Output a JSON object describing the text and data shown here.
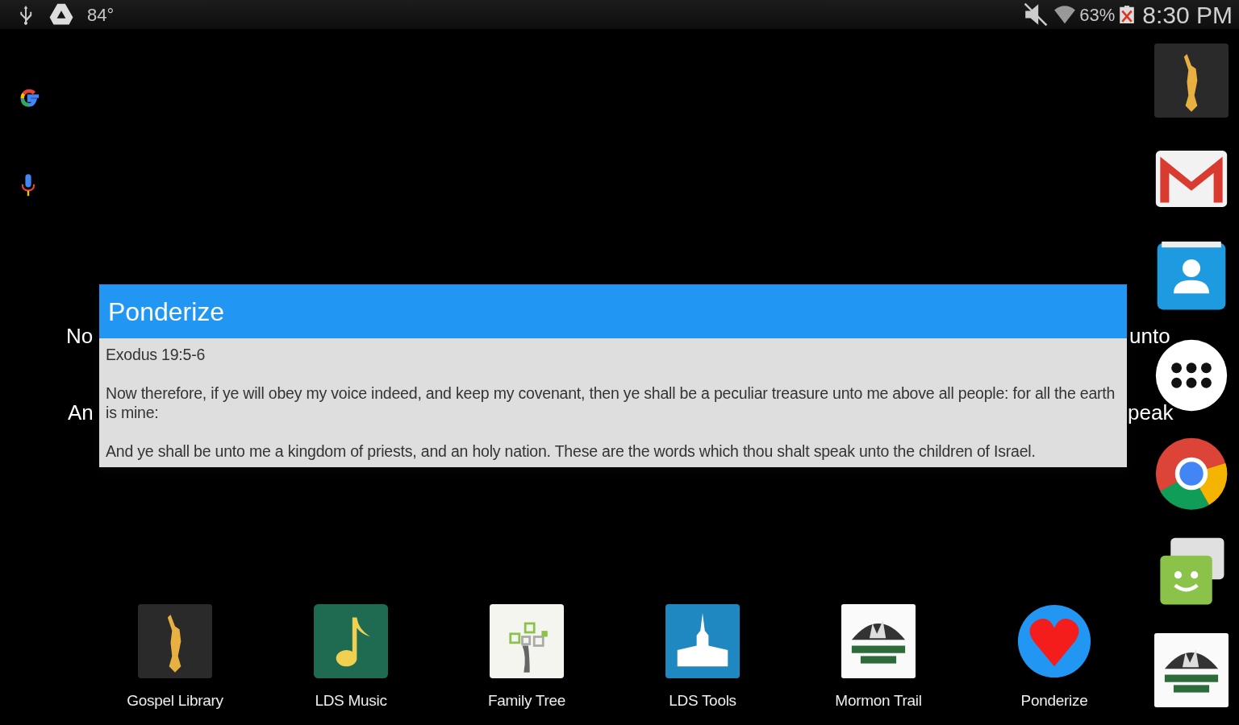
{
  "status_bar": {
    "temperature": "84°",
    "battery": "63%",
    "time": "8:30 PM"
  },
  "background_widget": {
    "line_1_start": "No",
    "line_1_end": "unto",
    "line_2_start": "An",
    "line_2_end": "peak"
  },
  "popup": {
    "title": "Ponderize",
    "reference": "Exodus 19:5-6",
    "verses": [
      "Now therefore, if ye will obey my voice indeed, and keep my covenant, then ye shall be a peculiar treasure unto me above all people: for all the earth is mine:",
      "And ye shall be unto me a kingdom of priests, and an holy nation. These are the words which thou shalt speak unto the children of Israel."
    ]
  },
  "dock_apps": [
    {
      "label": "Gospel Library"
    },
    {
      "label": "LDS Music"
    },
    {
      "label": "Family Tree"
    },
    {
      "label": "LDS Tools"
    },
    {
      "label": "Mormon Trail"
    },
    {
      "label": "Ponderize"
    }
  ]
}
